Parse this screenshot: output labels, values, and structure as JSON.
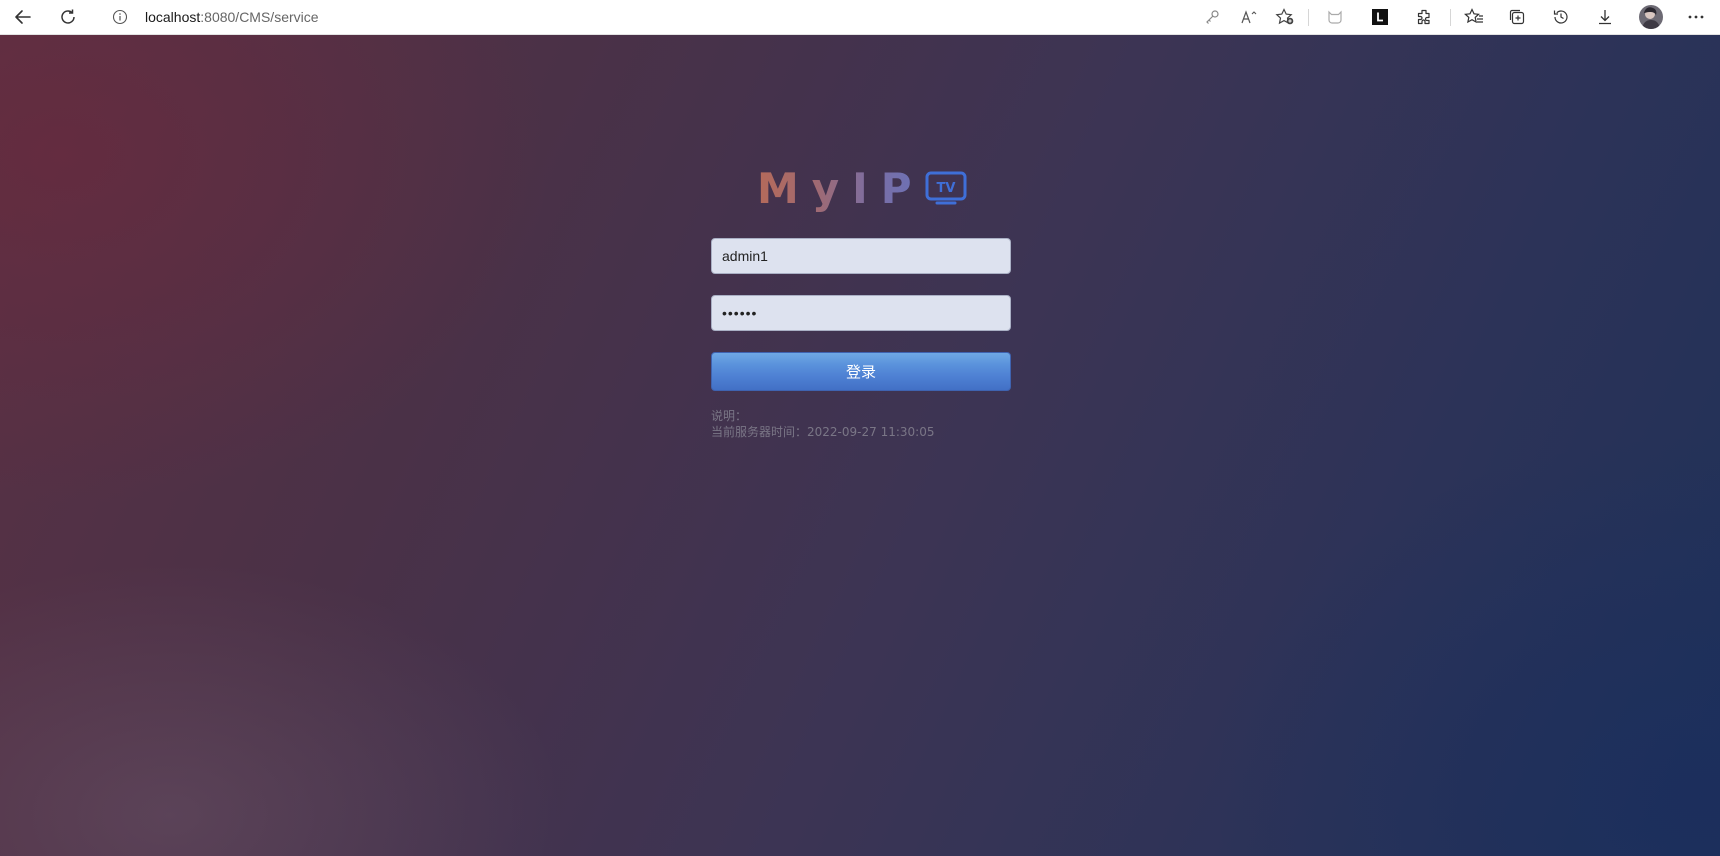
{
  "browser": {
    "url_host": "localhost",
    "url_rest": ":8080/CMS/service",
    "icons": [
      "back-icon",
      "refresh-icon",
      "info-icon",
      "key-icon",
      "read-aloud-icon",
      "add-favorite-icon",
      "extension-cat-icon",
      "extension-l-icon",
      "extensions-icon",
      "favorites-icon",
      "collections-icon",
      "history-icon",
      "download-icon",
      "profile-avatar",
      "more-icon"
    ]
  },
  "login": {
    "logo_text": "MyIP",
    "logo_badge": "TV",
    "username_value": "admin1",
    "password_value": "••••••",
    "submit_label": "登录",
    "note_title": "说明：",
    "server_time_label": "当前服务器时间：",
    "server_time_value": "2022-09-27 11:30:05"
  },
  "colors": {
    "button_blue": "#4f82d4",
    "field_bg": "#dde2ef",
    "logo_tv_blue": "#3f6fd8"
  }
}
